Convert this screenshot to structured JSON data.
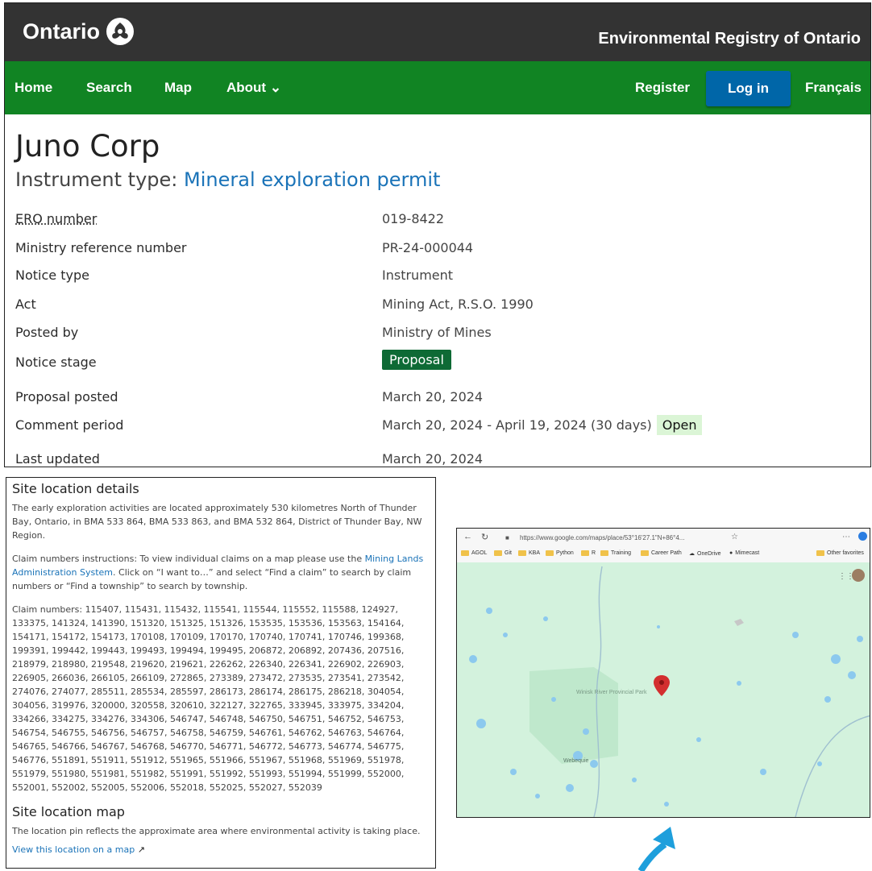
{
  "header": {
    "logo_text": "Ontario",
    "registry_title": "Environmental Registry of Ontario"
  },
  "nav": {
    "home": "Home",
    "search": "Search",
    "map": "Map",
    "about": "About",
    "register": "Register",
    "login": "Log in",
    "language": "Français"
  },
  "notice": {
    "title": "Juno Corp",
    "instrument_type_label": "Instrument type:",
    "instrument_type_value": "Mineral exploration permit",
    "fields": [
      {
        "label": "ERO number",
        "value": "019-8422"
      },
      {
        "label": "Ministry reference number",
        "value": "PR-24-000044"
      },
      {
        "label": "Notice type",
        "value": "Instrument"
      },
      {
        "label": "Act",
        "value": "Mining Act, R.S.O. 1990"
      },
      {
        "label": "Posted by",
        "value": "Ministry of Mines"
      },
      {
        "label": "Notice stage",
        "value": "Proposal"
      },
      {
        "label": "Proposal posted",
        "value": "March 20, 2024"
      },
      {
        "label": "Comment period",
        "value": "March 20, 2024 - April 19, 2024 (30 days)",
        "status": "Open"
      },
      {
        "label": "Last updated",
        "value": "March 20, 2024"
      }
    ]
  },
  "site": {
    "details_heading": "Site location details",
    "details_text": "The early exploration activities are located approximately 530 kilometres North of Thunder Bay, Ontario, in BMA 533 864, BMA 533 863, and BMA 532 864, District of Thunder Bay, NW Region.",
    "instructions_prefix": "Claim numbers instructions: To view individual claims on a map please use the",
    "instructions_link": "Mining Lands Administration System",
    "instructions_suffix": ". Click on “I want to…” and select “Find a claim” to search by claim numbers or “Find a township” to search by township.",
    "claim_numbers": "Claim numbers: 115407, 115431, 115432, 115541, 115544, 115552, 115588, 124927, 133375, 141324, 141390, 151320, 151325, 151326, 153535, 153536, 153563, 154164, 154171, 154172, 154173, 170108, 170109, 170170, 170740, 170741, 170746, 199368, 199391, 199442, 199443, 199493, 199494, 199495, 206872, 206892, 207436, 207516, 218979, 218980, 219548, 219620, 219621, 226262, 226340, 226341, 226902, 226903, 226905, 266036, 266105, 266109, 272865, 273389, 273472, 273535, 273541, 273542, 274076, 274077, 285511, 285534, 285597, 286173, 286174, 286175, 286218, 304054, 304056, 319976, 320000, 320558, 320610, 322127, 322765, 333945, 333975, 334204, 334266, 334275, 334276, 334306, 546747, 546748, 546750, 546751, 546752, 546753, 546754, 546755, 546756, 546757, 546758, 546759, 546761, 546762, 546763, 546764, 546765, 546766, 546767, 546768, 546770, 546771, 546772, 546773, 546774, 546775, 546776, 551891, 551911, 551912, 551965, 551966, 551967, 551968, 551969, 551978, 551979, 551980, 551981, 551982, 551991, 551992, 551993, 551994, 551999, 552000, 552001, 552002, 552005, 552006, 552018, 552025, 552027, 552039",
    "map_heading": "Site location map",
    "map_text": "The location pin reflects the approximate area where environmental activity is taking place.",
    "map_link": "View this location on a map"
  },
  "browser": {
    "url": "https://www.google.com/maps/place/53°16'27.1\"N+86°4...",
    "favorites": [
      "AGOL",
      "Git",
      "KBA",
      "Python",
      "R",
      "Training",
      "Career Path",
      "OneDrive",
      "Mimecast"
    ],
    "other_favorites": "Other favorites"
  },
  "map": {
    "park_label": "Winisk River Provincial Park",
    "place_label": "Webequie"
  },
  "colors": {
    "header_bg": "#333333",
    "nav_green": "#118423",
    "login_blue": "#0066a8",
    "stage_badge": "#0e6a35",
    "open_badge": "#dbf5d6",
    "link": "#1a73b8",
    "arrow": "#1e9fdc"
  }
}
